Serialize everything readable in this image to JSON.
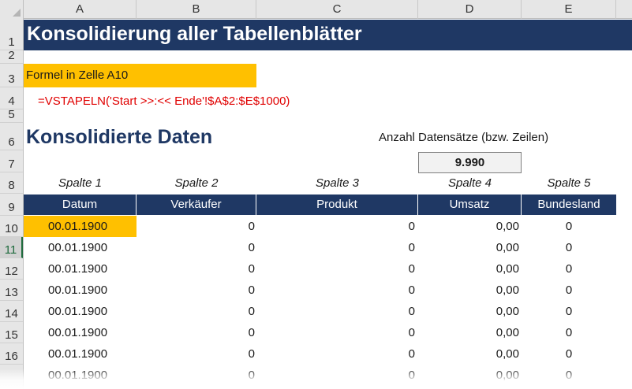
{
  "columns": [
    "A",
    "B",
    "C",
    "D",
    "E"
  ],
  "rows": [
    "1",
    "2",
    "3",
    "4",
    "5",
    "6",
    "7",
    "8",
    "9",
    "10",
    "11",
    "12",
    "13",
    "14",
    "15",
    "16"
  ],
  "title": "Konsolidierung aller Tabellenblätter",
  "formula_label": "Formel in Zelle A10",
  "formula": "=VSTAPELN('Start >>:<< Ende'!$A$2:$E$1000)",
  "subtitle": "Konsolidierte Daten",
  "count_label": "Anzahl Datensätze (bzw. Zeilen)",
  "count_value": "9.990",
  "column_labels": [
    "Spalte 1",
    "Spalte 2",
    "Spalte 3",
    "Spalte 4",
    "Spalte 5"
  ],
  "table_headers": [
    "Datum",
    "Verkäufer",
    "Produkt",
    "Umsatz",
    "Bundesland"
  ],
  "table_rows": [
    [
      "00.01.1900",
      "0",
      "0",
      "0,00",
      "0"
    ],
    [
      "00.01.1900",
      "0",
      "0",
      "0,00",
      "0"
    ],
    [
      "00.01.1900",
      "0",
      "0",
      "0,00",
      "0"
    ],
    [
      "00.01.1900",
      "0",
      "0",
      "0,00",
      "0"
    ],
    [
      "00.01.1900",
      "0",
      "0",
      "0,00",
      "0"
    ],
    [
      "00.01.1900",
      "0",
      "0",
      "0,00",
      "0"
    ],
    [
      "00.01.1900",
      "0",
      "0",
      "0,00",
      "0"
    ],
    [
      "00.01.1900",
      "0",
      "0",
      "0,00",
      "0"
    ]
  ],
  "colors": {
    "header_navy": "#1f3864",
    "highlight_yellow": "#ffc000",
    "formula_red": "#e00000"
  }
}
